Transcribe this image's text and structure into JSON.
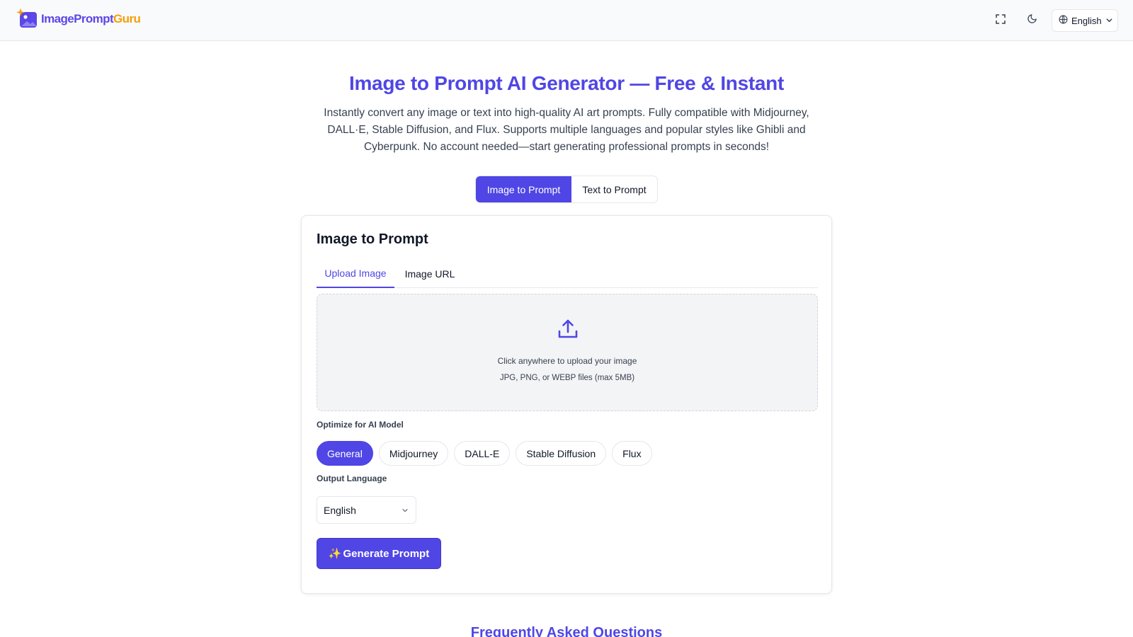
{
  "header": {
    "logo": {
      "part1": "ImagePrompt",
      "part2": "Guru",
      "icon": "image-sparkle-logo"
    },
    "fullscreen_icon": "fullscreen-icon",
    "theme_icon": "moon-icon",
    "language": {
      "label": "English",
      "icon": "globe-icon",
      "caret": "chevron-down-icon"
    }
  },
  "hero": {
    "title": "Image to Prompt AI Generator — Free & Instant",
    "description": "Instantly convert any image or text into high-quality AI art prompts. Fully compatible with Midjourney, DALL·E, Stable Diffusion, and Flux. Supports multiple languages and popular styles like Ghibli and Cyberpunk. No account needed—start generating professional prompts in seconds!"
  },
  "mode_tabs": [
    {
      "label": "Image to Prompt",
      "active": true
    },
    {
      "label": "Text to Prompt",
      "active": false
    }
  ],
  "card": {
    "title": "Image to Prompt",
    "sub_tabs": [
      {
        "label": "Upload Image",
        "active": true
      },
      {
        "label": "Image URL",
        "active": false
      }
    ],
    "upload": {
      "icon": "upload-icon",
      "primary_text": "Click anywhere to upload your image",
      "secondary_text": "JPG, PNG, or WEBP files (max 5MB)"
    },
    "model_section": {
      "label": "Optimize for AI Model",
      "options": [
        "General",
        "Midjourney",
        "DALL-E",
        "Stable Diffusion",
        "Flux"
      ],
      "selected": "General"
    },
    "language_section": {
      "label": "Output Language",
      "selected": "English"
    },
    "generate_button": {
      "icon": "✨",
      "label": "Generate Prompt"
    }
  },
  "faq": {
    "title": "Frequently Asked Questions"
  },
  "colors": {
    "accent": "#4f46e5",
    "logo_orange": "#f59e0b",
    "border": "#e5e7eb",
    "dropzone_bg": "#f3f4f6"
  }
}
